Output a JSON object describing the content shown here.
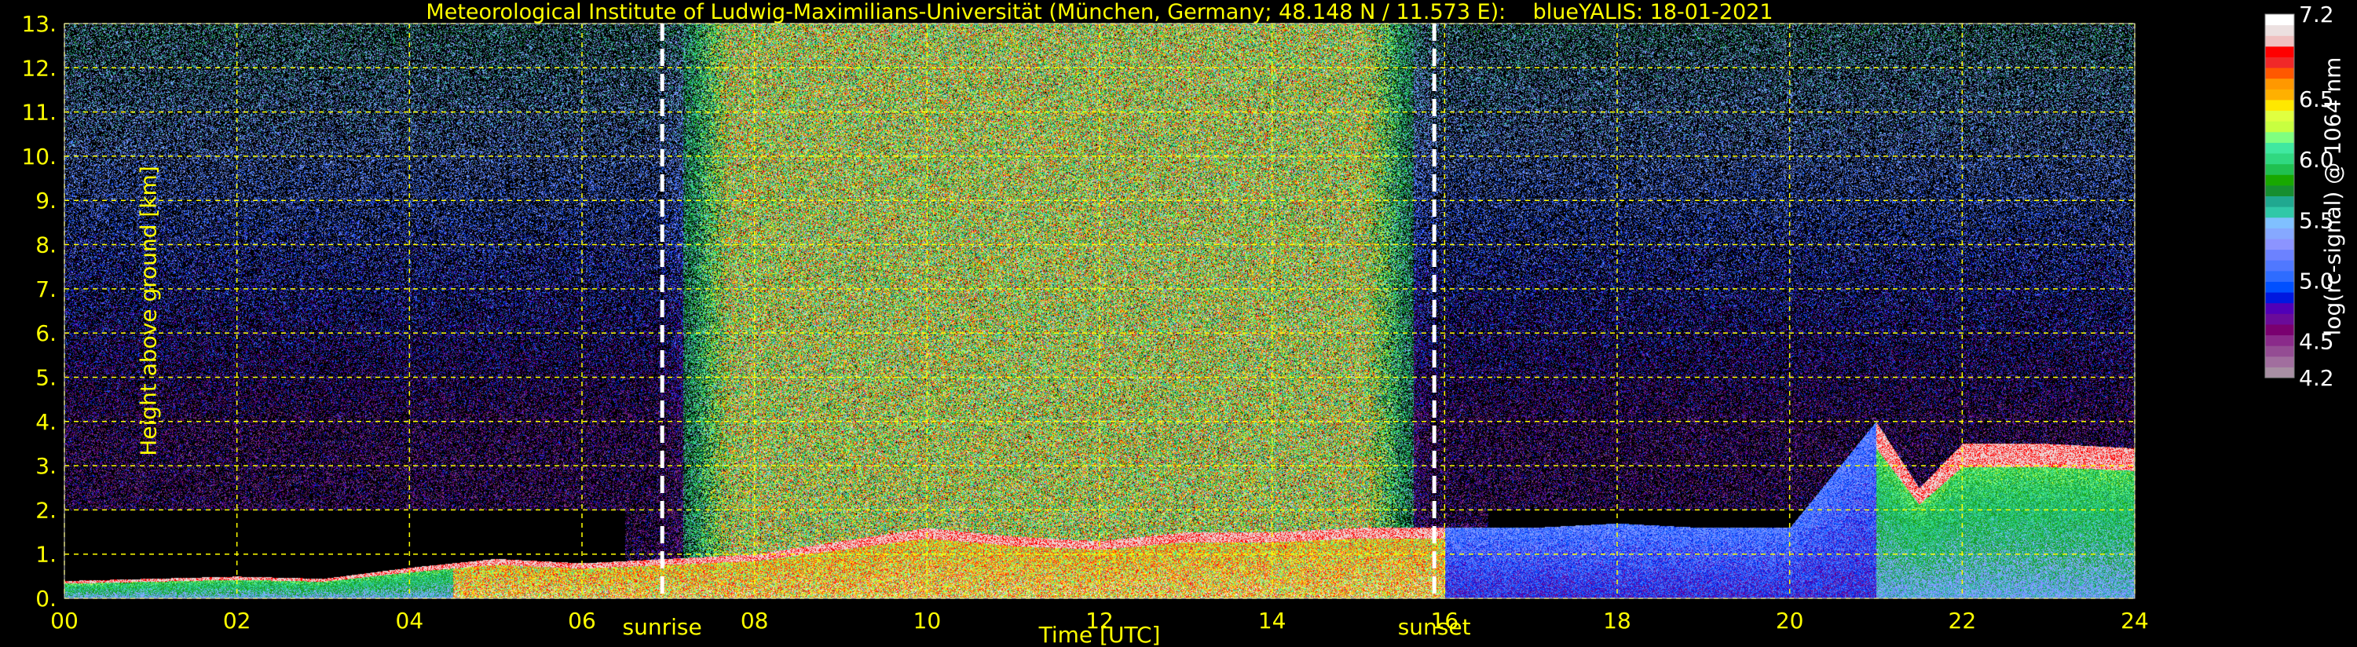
{
  "chart_data": {
    "type": "heatmap",
    "title": "Meteorological Institute of Ludwig-Maximilians-Universität (München, Germany; 48.148 N / 11.573 E):    blueYALIS: 18-01-2021",
    "xlabel": "Time [UTC]",
    "ylabel": "Height above ground [km]",
    "xlim": [
      0,
      24
    ],
    "ylim": [
      0,
      13
    ],
    "xticks": [
      "00",
      "02",
      "04",
      "06",
      "08",
      "10",
      "12",
      "14",
      "16",
      "18",
      "20",
      "22",
      "24"
    ],
    "yticks": [
      "0.",
      "1.",
      "2.",
      "3.",
      "4.",
      "5.",
      "6.",
      "7.",
      "8.",
      "9.",
      "10.",
      "11.",
      "12.",
      "13."
    ],
    "grid": true,
    "annotations": [
      {
        "label": "sunrise",
        "time": 6.93
      },
      {
        "label": "sunset",
        "time": 15.88
      }
    ],
    "colorbar": {
      "label": "log(rc-signal) @ 1064 nm",
      "range": [
        4.2,
        7.2
      ],
      "ticks": [
        "4.2",
        "4.5",
        "5.0",
        "5.5",
        "6.0",
        "6.5",
        "7.2"
      ],
      "colors": [
        "#a88fa3",
        "#a16e9e",
        "#944c93",
        "#8a2a8a",
        "#7a0070",
        "#6a0b9a",
        "#5000b8",
        "#0018e0",
        "#0050ff",
        "#2e6cff",
        "#5078ff",
        "#6c82ff",
        "#8c94ff",
        "#86a8ff",
        "#80c0ff",
        "#30c8a8",
        "#20a890",
        "#168e30",
        "#18a800",
        "#20c050",
        "#30d880",
        "#40e8a0",
        "#80ff80",
        "#c8ff40",
        "#e0ff40",
        "#ffe800",
        "#ffb000",
        "#ff9800",
        "#ff5800",
        "#f02828",
        "#ff0000",
        "#f0c0c0",
        "#ece0e0",
        "#ffffff"
      ]
    },
    "layer_top_km": {
      "time": [
        0,
        1,
        2,
        3,
        4,
        5,
        6,
        7,
        8,
        9,
        10,
        11,
        12,
        13,
        14,
        15,
        16,
        17,
        18,
        19,
        20,
        21,
        21.5,
        22,
        23,
        24
      ],
      "height": [
        0.4,
        0.45,
        0.5,
        0.45,
        0.7,
        0.9,
        0.8,
        0.9,
        1.0,
        1.3,
        1.6,
        1.4,
        1.3,
        1.5,
        1.5,
        1.6,
        1.6,
        1.6,
        1.7,
        1.6,
        1.6,
        4.0,
        2.5,
        3.5,
        3.5,
        3.4
      ]
    },
    "daylight_noise": {
      "start": 6.93,
      "end": 15.88
    }
  }
}
